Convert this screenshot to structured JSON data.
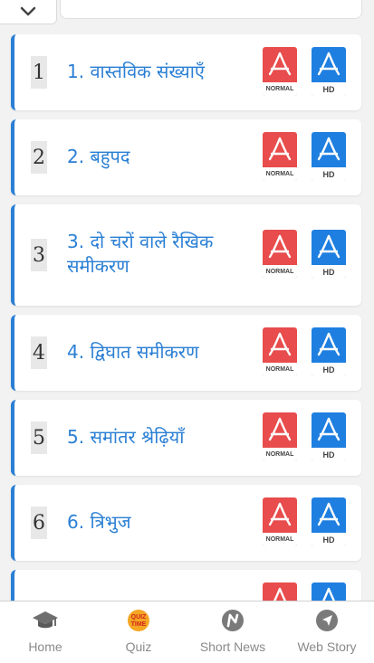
{
  "chapters": [
    {
      "num": "1",
      "title": "1. वास्तविक संख्याएँ",
      "normal": "NORMAL",
      "hd": "HD"
    },
    {
      "num": "2",
      "title": "2. बहुपद",
      "normal": "NORMAL",
      "hd": "HD"
    },
    {
      "num": "3",
      "title": "3. दो चरों वाले रैखिक समीकरण",
      "normal": "NORMAL",
      "hd": "HD"
    },
    {
      "num": "4",
      "title": "4. द्विघात समीकरण",
      "normal": "NORMAL",
      "hd": "HD"
    },
    {
      "num": "5",
      "title": "5. समांतर श्रेढ़ियाँ",
      "normal": "NORMAL",
      "hd": "HD"
    },
    {
      "num": "6",
      "title": "6. त्रिभुज",
      "normal": "NORMAL",
      "hd": "HD"
    }
  ],
  "nav": {
    "home": "Home",
    "quiz": "Quiz",
    "short_news": "Short News",
    "web_story": "Web Story"
  },
  "icons": {
    "collapse": "chevron-down-icon",
    "pdf": "pdf-icon",
    "home": "graduation-cap-icon",
    "quiz": "quiz-time-icon",
    "short_news": "news-icon",
    "web_story": "navigation-arrow-icon"
  },
  "colors": {
    "accent": "#2a7fd4",
    "pdf_normal": "#e84c4c",
    "pdf_hd": "#1e7fe0",
    "quiz_badge": "#f5a623"
  }
}
